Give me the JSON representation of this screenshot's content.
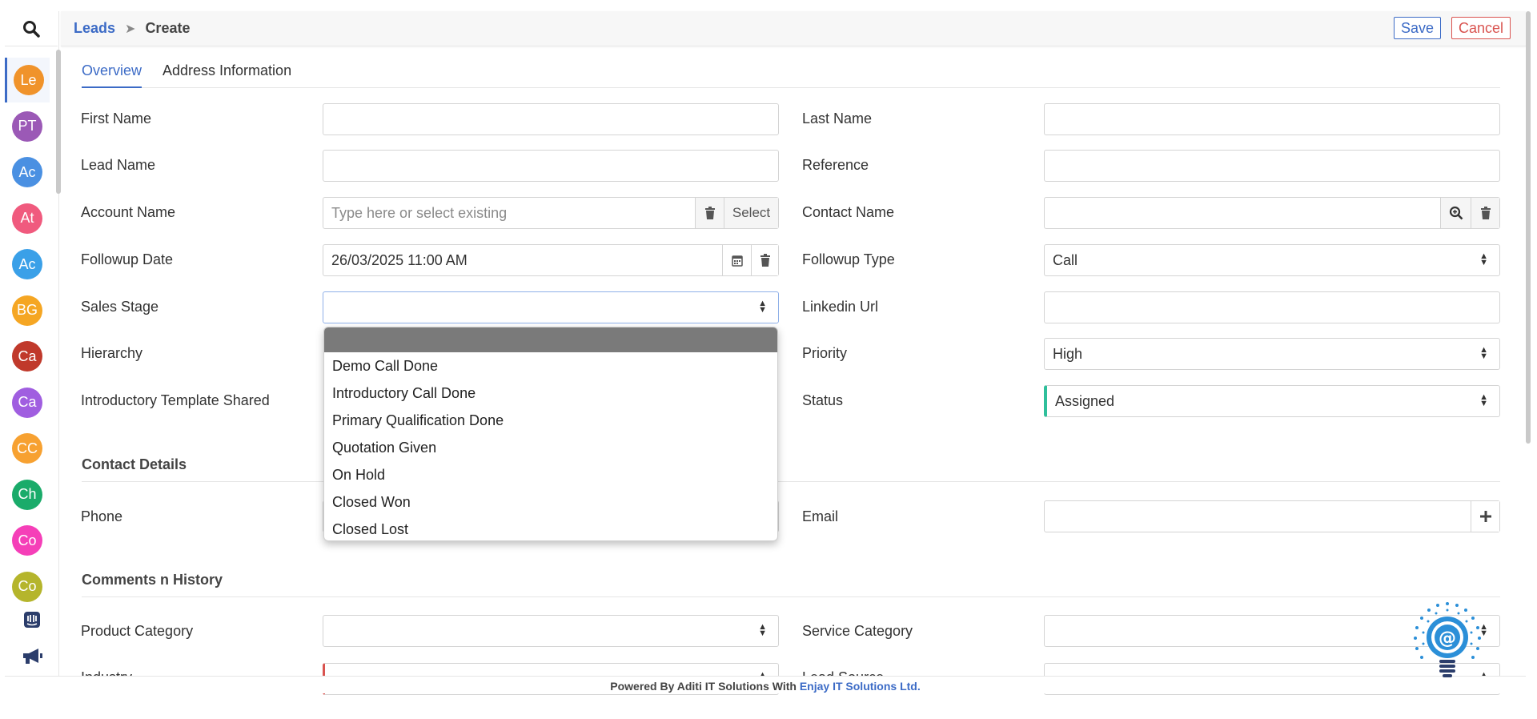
{
  "sidebar": {
    "search_icon": "search-icon",
    "items": [
      {
        "label": "Le",
        "color": "#f0932b"
      },
      {
        "label": "PT",
        "color": "#9b59b6"
      },
      {
        "label": "Ac",
        "color": "#4a90e2"
      },
      {
        "label": "At",
        "color": "#f05a7e"
      },
      {
        "label": "Ac",
        "color": "#3aa0e8"
      },
      {
        "label": "BG",
        "color": "#f5a623"
      },
      {
        "label": "Ca",
        "color": "#c0392b"
      },
      {
        "label": "Ca",
        "color": "#a05ee0"
      },
      {
        "label": "CC",
        "color": "#f7a131"
      },
      {
        "label": "Ch",
        "color": "#1aab6a"
      },
      {
        "label": "Co",
        "color": "#f53fb8"
      },
      {
        "label": "Co",
        "color": "#b5b52c"
      }
    ],
    "bottom_icons": [
      "intercom-icon",
      "megaphone-icon"
    ]
  },
  "header": {
    "breadcrumb_root": "Leads",
    "breadcrumb_current": "Create",
    "save_label": "Save",
    "cancel_label": "Cancel"
  },
  "tabs": [
    "Overview",
    "Address Information"
  ],
  "form": {
    "first_name": {
      "label": "First Name",
      "value": ""
    },
    "last_name": {
      "label": "Last Name",
      "value": ""
    },
    "lead_name": {
      "label": "Lead Name",
      "value": ""
    },
    "reference": {
      "label": "Reference",
      "value": ""
    },
    "account_name": {
      "label": "Account Name",
      "placeholder": "Type here or select existing",
      "select_label": "Select"
    },
    "contact_name": {
      "label": "Contact Name",
      "value": ""
    },
    "followup_date": {
      "label": "Followup Date",
      "value": "26/03/2025 11:00 AM"
    },
    "followup_type": {
      "label": "Followup Type",
      "value": "Call"
    },
    "sales_stage": {
      "label": "Sales Stage",
      "value": ""
    },
    "linkedin_url": {
      "label": "Linkedin Url",
      "value": ""
    },
    "hierarchy": {
      "label": "Hierarchy"
    },
    "priority": {
      "label": "Priority",
      "value": "High"
    },
    "intro_template": {
      "label": "Introductory Template Shared"
    },
    "status": {
      "label": "Status",
      "value": "Assigned"
    }
  },
  "contact_details": {
    "title": "Contact Details",
    "phone_label": "Phone",
    "email_label": "Email"
  },
  "comments": {
    "title": "Comments n History",
    "product_category_label": "Product Category",
    "service_category_label": "Service Category",
    "industry_label": "Industry",
    "lead_source_label": "Lead Source"
  },
  "sales_stage_options": [
    "Demo Call Done",
    "Introductory Call Done",
    "Primary Qualification Done",
    "Quotation Given",
    "On Hold",
    "Closed Won",
    "Closed Lost"
  ],
  "footer": {
    "text": "Powered By Aditi IT Solutions With",
    "link": "Enjay IT Solutions Ltd."
  }
}
